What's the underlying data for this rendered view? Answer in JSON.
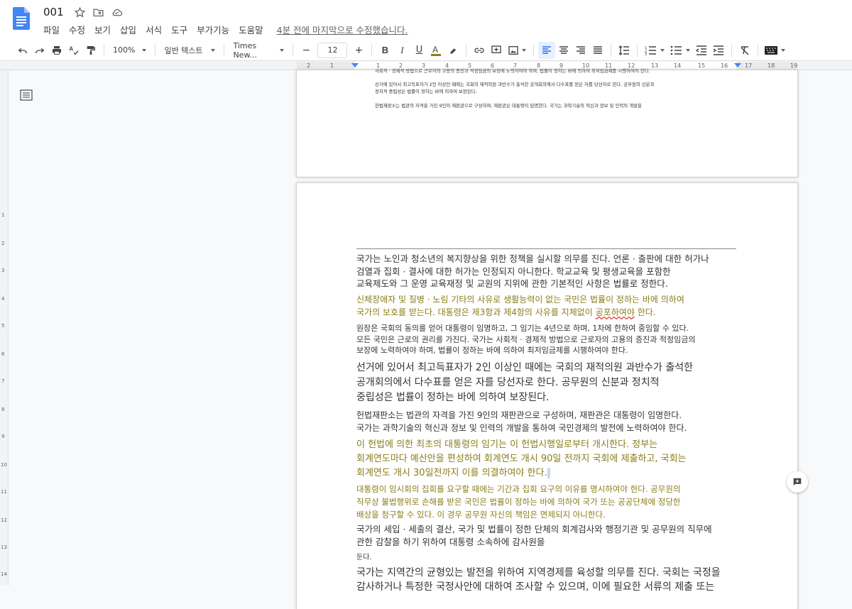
{
  "doc": {
    "title": "001",
    "last_edit": "4분 전에 마지막으로 수정했습니다."
  },
  "menu": [
    "파일",
    "수정",
    "보기",
    "삽입",
    "서식",
    "도구",
    "부가기능",
    "도움말"
  ],
  "toolbar": {
    "zoom": "100%",
    "style": "일반 텍스트",
    "font": "Times New...",
    "font_size": "12",
    "icons": [
      "undo-icon",
      "redo-icon",
      "print-icon",
      "spellcheck-icon",
      "paint-format-icon",
      "bold-icon",
      "italic-icon",
      "underline-icon",
      "text-color-icon",
      "highlight-icon",
      "link-icon",
      "comment-icon",
      "image-icon",
      "align-left-icon",
      "align-center-icon",
      "align-right-icon",
      "justify-icon",
      "line-spacing-icon",
      "numbered-list-icon",
      "bulleted-list-icon",
      "decrease-indent-icon",
      "increase-indent-icon",
      "clear-formatting-icon",
      "input-tools-icon"
    ]
  },
  "ruler": {
    "marks": [
      "2",
      "1",
      "1",
      "2",
      "3",
      "4",
      "5",
      "6",
      "7",
      "8",
      "9",
      "10",
      "11",
      "12",
      "13",
      "14",
      "15",
      "16",
      "17",
      "18",
      "19"
    ]
  },
  "vruler": {
    "marks": [
      "1",
      "2",
      "3",
      "4",
      "5",
      "6",
      "7",
      "8",
      "9",
      "10",
      "11",
      "12",
      "13",
      "14"
    ]
  },
  "page1": {
    "lines": [
      "사회적 · 경제적 방법으로 근로자의 고용의 증진과 적정임금의 보장에 노력하여야 하며, 법률이 정하는 바에 의하여 최저임금제를 시행하여야 한다.",
      "선거에 있어서 최고득표자가 2인 이상인 때에는 국회의 재적의원 과반수가 출석한 공개회의에서 다수표를 얻은 자를 당선자로 한다. 공무원의 신분과",
      "정치적 중립성은 법률이 정하는 바에 의하여 보장된다.",
      "헌법재판소는 법관의 자격을 가진 9인의 재판관으로 구성하며, 재판관은 대통령이 임명한다. 국가는 과학기술의 혁신과 정보 및 인력의 개발을"
    ]
  },
  "page2": {
    "paragraphs": [
      {
        "lines": [
          "국가는 노인과 청소년의 복지향상을 위한 정책을 실시할 의무를 진다. 언론 · 출판에 대한 허가나",
          "검열과 집회 · 결사에 대한 허가는 인정되지 아니한다. 학교교육 및 평생교육을 포함한",
          "교육제도와 그 운영 교육재정 및 교원의 지위에 관한 기본적인 사항은 법률로 정한다."
        ]
      },
      {
        "lines": [
          "신체장애자 및 질병 · 노림 기타의 사유로 생활능력이 없는 국민은 법률이 정하는 바에 의하여",
          "국가의 보호를 받는다. 대통령은 제3항과 제4항의 사유를 지체없이"
        ],
        "squiggle": "공포하여야",
        "tail": " 한다."
      },
      {
        "lines": [
          "원장은 국회의 동의를 얻어 대통령이 임명하고, 그 임기는 4년으로 하며, 1차에 한하여 중임할 수 있다.",
          "모든 국민은 근로의 권리를 가진다. 국가는 사회적 · 경제적 방법으로 근로자의 고용의 증진과 적정임금의",
          "보장에 노력하여야 하며, 법률이 정하는 바에 의하여 최저임금제를 시행하여야 한다."
        ]
      },
      {
        "lines": [
          "선거에 있어서 최고득표자가 2인 이상인 때에는 국회의 재적의원 과반수가 출석한",
          "공개회의에서 다수표를 얻은 자를 당선자로 한다. 공무원의 신분과 정치적",
          "중립성은 법률이 정하는 바에 의하여 보장된다."
        ]
      },
      {
        "lines": [
          "헌법재판소는 법관의 자격을 가진 9인의 재판관으로 구성하며, 재판관은 대통령이 임명한다.",
          "국가는 과학기술의 혁신과 정보 및 인력의 개발을 통하여 국민경제의 발전에 노력하여야 한다."
        ]
      },
      {
        "lines": [
          "이 헌법에 의한 최초의 대통령의 임기는 이 헌법시행일로부터 개시한다. 정부는",
          "회계연도마다 예산안을 편성하여 회계연도 개시 90일 전까지 국회에 제출하고, 국회는",
          "회계연도 개시 30일전까지 이를 의결하여야 한다."
        ]
      },
      {
        "lines": [
          "대통령이 임시회의 집회를 요구할 때에는 기간과 집회 요구의 이유를 명시하여야 한다. 공무원의",
          "직무상 불법행위로 손해를 받은 국민은 법률이 정하는 바에 의하여 국가 또는 공공단체에 정당한",
          "배상을 청구할 수 있다. 이 경우 공무원 자신의 책임은 면제되지 아니한다."
        ]
      },
      {
        "lines": [
          "국가의 세입 · 세출의 결산, 국가 및 법률이 정한 단체의 회계검사와 행정기관 및 공무원의 직무에",
          "관한 감찰을 하기 위하여 대통령 소속하에 감사원을"
        ]
      },
      {
        "lines": [
          "둔다."
        ]
      },
      {
        "lines": [
          "국가는 지역간의 균형있는 발전을 위하여 지역경제를 육성할 의무를 진다. 국회는 국정을",
          "감사하거나 특정한 국정사안에 대하여 조사할 수 있으며, 이에 필요한 서류의 제출 또는"
        ]
      }
    ]
  }
}
